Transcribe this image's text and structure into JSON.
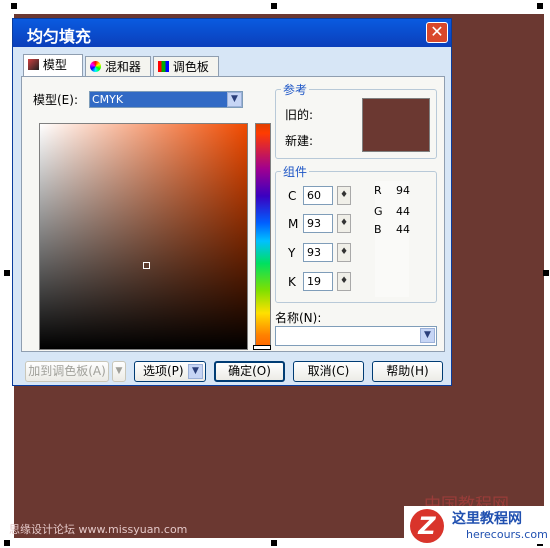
{
  "dialog": {
    "title": "均匀填充",
    "close_glyph": "✕",
    "tabs": [
      {
        "label": "模型",
        "icon": "model-icon"
      },
      {
        "label": "混和器",
        "icon": "mixer-icon"
      },
      {
        "label": "调色板",
        "icon": "palette-icon"
      }
    ],
    "model_label": "模型(E):",
    "model_value": "CMYK",
    "reference": {
      "title": "参考",
      "old_label": "旧的:",
      "new_label": "新建:",
      "color": "#6b3831"
    },
    "components": {
      "title": "组件",
      "cmyk": [
        {
          "label": "C",
          "value": "60"
        },
        {
          "label": "M",
          "value": "93"
        },
        {
          "label": "Y",
          "value": "93"
        },
        {
          "label": "K",
          "value": "19"
        }
      ],
      "rgb": [
        {
          "label": "R",
          "value": "94"
        },
        {
          "label": "G",
          "value": "44"
        },
        {
          "label": "B",
          "value": "44"
        }
      ]
    },
    "name_label": "名称(N):",
    "name_value": "",
    "buttons": {
      "add_palette": "加到调色板(A)",
      "options": "选项(P)",
      "ok": "确定(O)",
      "cancel": "取消(C)",
      "help": "帮助(H)"
    }
  },
  "canvas_color": "#6b3831",
  "watermarks": {
    "left": "思缘设计论坛 www.missyuan.com",
    "right": "中国教程网",
    "logo_title": "这里教程网",
    "logo_url": "herecours.com"
  }
}
